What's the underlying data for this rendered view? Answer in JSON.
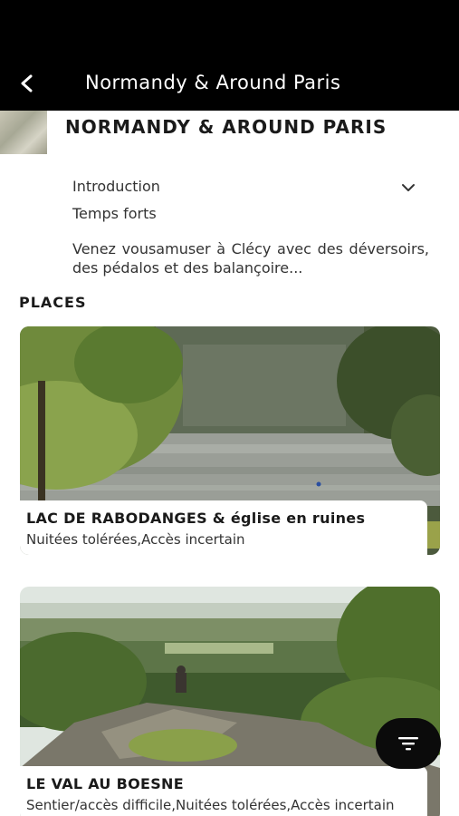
{
  "appbar": {
    "title": "Normandy & Around Paris"
  },
  "page": {
    "title": "NORMANDY & AROUND PARIS",
    "accordion_label": "Introduction",
    "section_label": "Temps forts",
    "description": "Venez vousamuser à Clécy avec des déversoirs, des pédalos et des balançoire..."
  },
  "places": {
    "heading": "PLACES",
    "items": [
      {
        "title": "LAC DE RABODANGES & église en ruines",
        "tags": "Nuitées tolérées,Accès incertain"
      },
      {
        "title": "LE VAL AU BOESNE",
        "tags": "Sentier/accès difficile,Nuitées tolérées,Accès incertain"
      }
    ]
  },
  "icons": {
    "back": "back-arrow-icon",
    "chevron": "chevron-down-icon",
    "filter": "filter-icon"
  },
  "colors": {
    "appbar_bg": "#000000",
    "fab_bg": "#0b0b0b"
  }
}
